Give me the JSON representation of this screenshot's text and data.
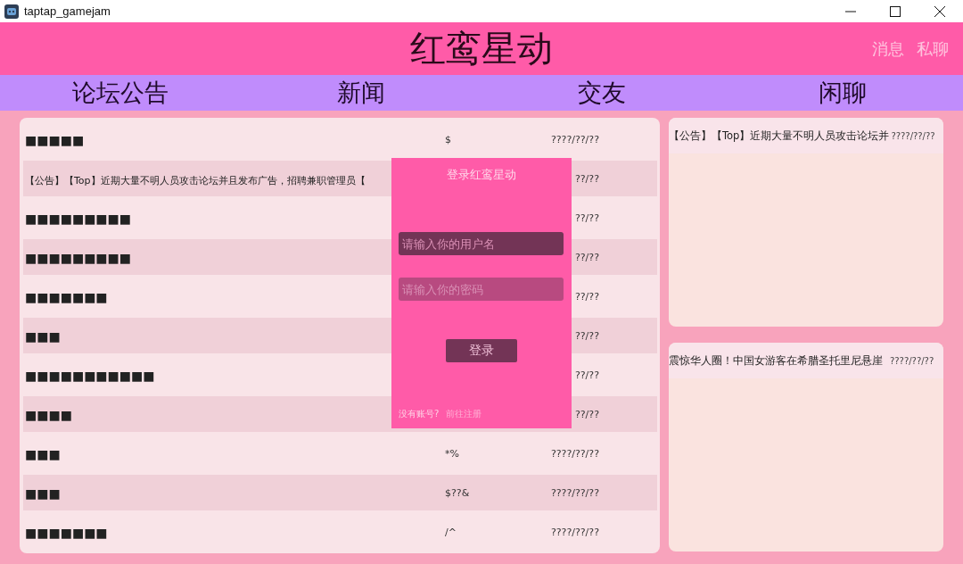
{
  "window": {
    "title": "taptap_gamejam"
  },
  "header": {
    "title": "红鸾星动",
    "links": [
      "消息",
      "私聊"
    ]
  },
  "nav": {
    "tabs": [
      "论坛公告",
      "新闻",
      "交友",
      "闲聊"
    ]
  },
  "posts": [
    {
      "title": "■■■■■",
      "column_2": "$",
      "date": "????/??/??"
    },
    {
      "title": "【公告】【Top】近期大量不明人员攻击论坛并且发布广告，招聘兼职管理员【",
      "date": "??/??"
    },
    {
      "title": "■■■■■■■■■",
      "date": "??/??"
    },
    {
      "title": "■■■■■■■■■",
      "date": "??/??"
    },
    {
      "title": "■■■■■■■",
      "date": "??/??"
    },
    {
      "title": "■■■",
      "date": "??/??"
    },
    {
      "title": "■■■■■■■■■■■",
      "date": "??/??"
    },
    {
      "title": "■■■■",
      "date": "??/??"
    },
    {
      "title": "■■■",
      "column_2": "*%",
      "date": "????/??/??"
    },
    {
      "title": "■■■",
      "column_2": "$??&",
      "date": "????/??/??"
    },
    {
      "title": "■■■■■■■",
      "column_2": "/^",
      "date": "????/??/??"
    }
  ],
  "side_panels": [
    {
      "items": [
        {
          "title": "【公告】【Top】近期大量不明人员攻击论坛并",
          "date": "????/??/??"
        }
      ]
    },
    {
      "items": [
        {
          "title": "震惊华人圈！中国女游客在希腊圣托里尼悬崖",
          "date": "????/??/??"
        }
      ]
    }
  ],
  "login": {
    "title": "登录红鸾星动",
    "username": {
      "placeholder": "请输入你的用户名"
    },
    "password": {
      "placeholder": "请输入你的密码"
    },
    "button": "登录",
    "prompt": "没有账号?",
    "register_link": "前往注册"
  }
}
